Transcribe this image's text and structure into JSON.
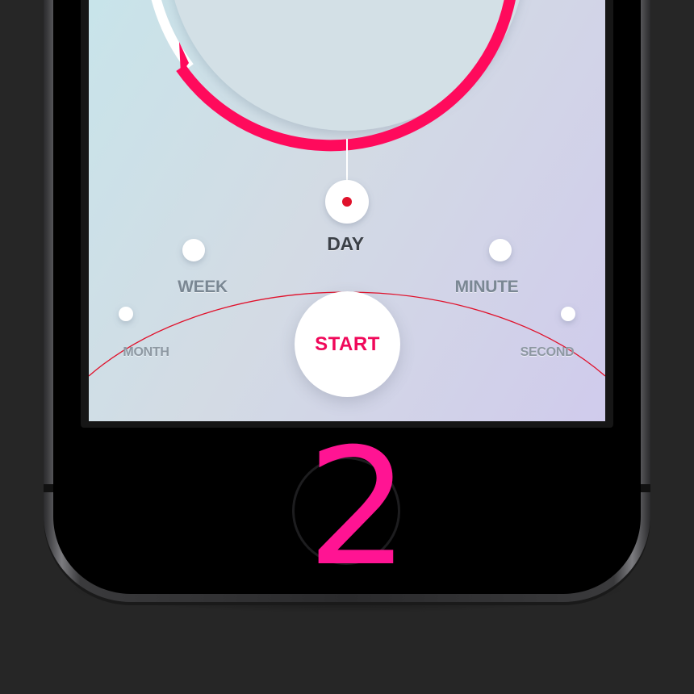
{
  "timer": {
    "start_label": "START",
    "units": [
      "MONTH",
      "WEEK",
      "DAY",
      "MINUTE",
      "SECOND"
    ],
    "selected_unit": "DAY"
  },
  "overlay": {
    "step_number": "2"
  },
  "colors": {
    "accent": "#ff0a5c",
    "dial_red": "#e0112b",
    "step_number": "#ff1493",
    "background": "#262626"
  }
}
